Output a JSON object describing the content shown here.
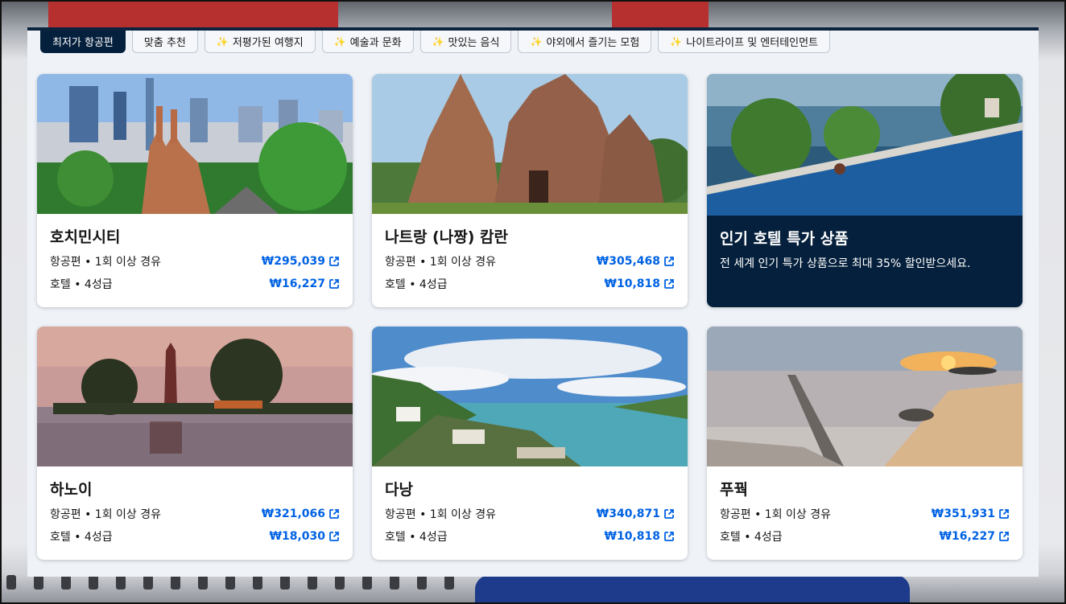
{
  "filters": [
    {
      "label": "최저가 항공편",
      "active": true,
      "sparkle": false
    },
    {
      "label": "맞춤 추천",
      "active": false,
      "sparkle": false
    },
    {
      "label": "저평가된 여행지",
      "active": false,
      "sparkle": true
    },
    {
      "label": "예술과 문화",
      "active": false,
      "sparkle": true
    },
    {
      "label": "맛있는 음식",
      "active": false,
      "sparkle": true
    },
    {
      "label": "야외에서 즐기는 모험",
      "active": false,
      "sparkle": true
    },
    {
      "label": "나이트라이프 및 엔터테인먼트",
      "active": false,
      "sparkle": true
    }
  ],
  "sparkle_glyph": "✨",
  "flight_label": "항공편 • 1회 이상 경유",
  "hotel_label": "호텔 • 4성급",
  "destinations": [
    {
      "city": "호치민시티",
      "flight_price": "₩295,039",
      "hotel_price": "₩16,227"
    },
    {
      "city": "나트랑 (나짱) 캄란",
      "flight_price": "₩305,468",
      "hotel_price": "₩10,818"
    },
    {
      "city": "하노이",
      "flight_price": "₩321,066",
      "hotel_price": "₩18,030"
    },
    {
      "city": "다낭",
      "flight_price": "₩340,871",
      "hotel_price": "₩10,818"
    },
    {
      "city": "푸꿕",
      "flight_price": "₩351,931",
      "hotel_price": "₩16,227"
    }
  ],
  "promo": {
    "title": "인기 호텔 특가 상품",
    "description": "전 세계 인기 특가 상품으로 최대 35% 할인받으세요."
  },
  "colors": {
    "accent": "#0062e3",
    "dark": "#05203c",
    "panel": "#eff3f8"
  },
  "icons": {
    "external_link": "external-link-icon"
  }
}
